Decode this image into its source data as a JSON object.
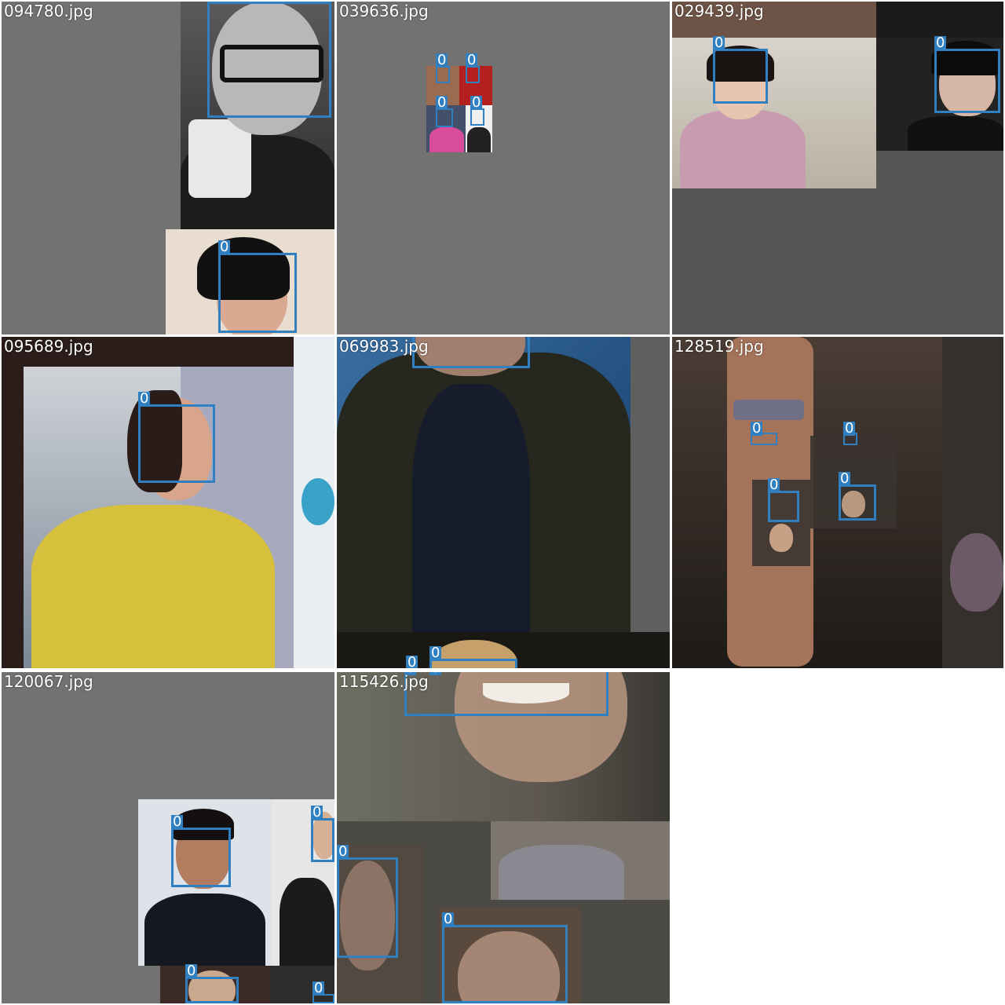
{
  "grid": {
    "tiles": [
      {
        "filename": "094780.jpg",
        "boxes": [
          {
            "label": "0"
          },
          {
            "label": "0"
          }
        ]
      },
      {
        "filename": "039636.jpg",
        "boxes": [
          {
            "label": "0"
          },
          {
            "label": "0"
          },
          {
            "label": "0"
          },
          {
            "label": "0"
          }
        ]
      },
      {
        "filename": "029439.jpg",
        "boxes": [
          {
            "label": "0"
          },
          {
            "label": "0"
          }
        ]
      },
      {
        "filename": "095689.jpg",
        "boxes": [
          {
            "label": "0"
          }
        ]
      },
      {
        "filename": "069983.jpg",
        "boxes": [
          {
            "label": "0"
          },
          {
            "label": "0"
          },
          {
            "label": "0"
          }
        ]
      },
      {
        "filename": "128519.jpg",
        "boxes": [
          {
            "label": "0"
          },
          {
            "label": "0"
          },
          {
            "label": "0"
          },
          {
            "label": "0"
          }
        ]
      },
      {
        "filename": "120067.jpg",
        "boxes": [
          {
            "label": "0"
          },
          {
            "label": "0"
          },
          {
            "label": "0"
          },
          {
            "label": "0"
          }
        ]
      },
      {
        "filename": "115426.jpg",
        "boxes": [
          {
            "label": "0"
          },
          {
            "label": "0"
          },
          {
            "label": "0"
          },
          {
            "label": "0"
          }
        ]
      }
    ]
  },
  "colors": {
    "box": "#2f7fc1",
    "padding_gray": "#727272",
    "background": "#ffffff"
  }
}
